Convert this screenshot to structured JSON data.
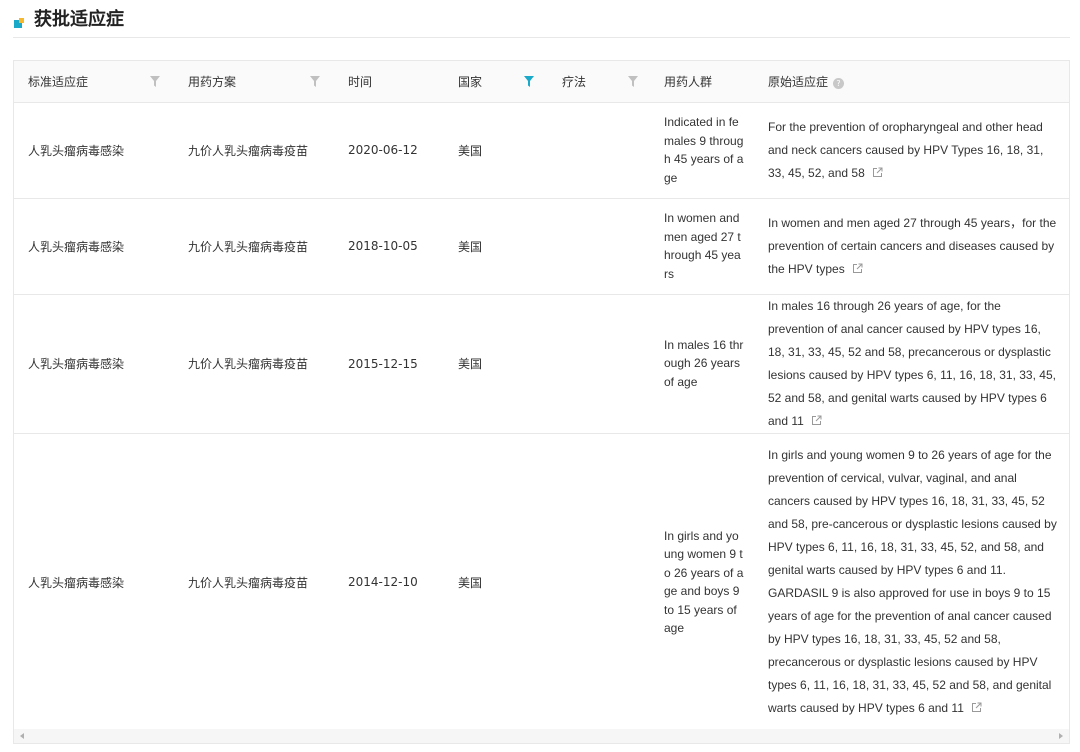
{
  "section": {
    "title": "获批适应症",
    "accent_color": "#1aa9c9",
    "accent_secondary": "#f5b82e"
  },
  "table": {
    "columns": [
      {
        "label": "标准适应症",
        "filter": true,
        "filter_active": false
      },
      {
        "label": "用药方案",
        "filter": true,
        "filter_active": false
      },
      {
        "label": "时间",
        "filter": false,
        "filter_active": false
      },
      {
        "label": "国家",
        "filter": true,
        "filter_active": true
      },
      {
        "label": "疗法",
        "filter": true,
        "filter_active": false
      },
      {
        "label": "用药人群",
        "filter": false,
        "filter_active": false
      },
      {
        "label": "原始适应症",
        "filter": false,
        "filter_active": false,
        "help_icon": "question-circle-icon"
      }
    ],
    "help_glyph": "?",
    "filter_colors": {
      "inactive": "#c0c0c0",
      "active": "#1aa9c9"
    },
    "rows": [
      {
        "indication": "人乳头瘤病毒感染",
        "regimen": "九价人乳头瘤病毒疫苗",
        "date": "2020-06-12",
        "country": "美国",
        "therapy": "",
        "population": "Indicated in females 9 through 45 years of age",
        "original": "For the prevention of oropharyngeal and other head and neck cancers caused by HPV Types 16, 18, 31, 33, 45, 52, and 58"
      },
      {
        "indication": "人乳头瘤病毒感染",
        "regimen": "九价人乳头瘤病毒疫苗",
        "date": "2018-10-05",
        "country": "美国",
        "therapy": "",
        "population": "In women and men aged 27 through 45 years",
        "original": "In women and men aged 27 through 45 years，for the prevention of certain cancers and diseases caused by the HPV types"
      },
      {
        "indication": "人乳头瘤病毒感染",
        "regimen": "九价人乳头瘤病毒疫苗",
        "date": "2015-12-15",
        "country": "美国",
        "therapy": "",
        "population": "In males 16 through 26 years of age",
        "original": "In males 16 through 26 years of age, for the prevention of anal cancer caused by HPV types 16, 18, 31, 33, 45, 52 and 58, precancerous or dysplastic lesions caused by HPV types 6, 11, 16, 18, 31, 33, 45, 52 and 58, and genital warts caused by HPV types 6 and 11"
      },
      {
        "indication": "人乳头瘤病毒感染",
        "regimen": "九价人乳头瘤病毒疫苗",
        "date": "2014-12-10",
        "country": "美国",
        "therapy": "",
        "population": "In girls and young women 9 to 26 years of age and boys 9 to 15 years of age",
        "original": "In girls and young women 9 to 26 years of age for the prevention of cervical, vulvar, vaginal, and anal cancers caused by HPV types 16, 18, 31, 33, 45, 52 and 58, pre-cancerous or dysplastic lesions caused by HPV types 6, 11, 16, 18, 31, 33, 45, 52, and 58, and genital warts caused by HPV types 6 and 11. GARDASIL 9 is also approved for use in boys 9 to 15 years of age for the prevention of anal cancer caused by HPV types 16, 18, 31, 33, 45, 52 and 58, precancerous or dysplastic lesions caused by HPV types 6, 11, 16, 18, 31, 33, 45, 52 and 58, and genital warts caused by HPV types 6 and 11"
      }
    ]
  }
}
